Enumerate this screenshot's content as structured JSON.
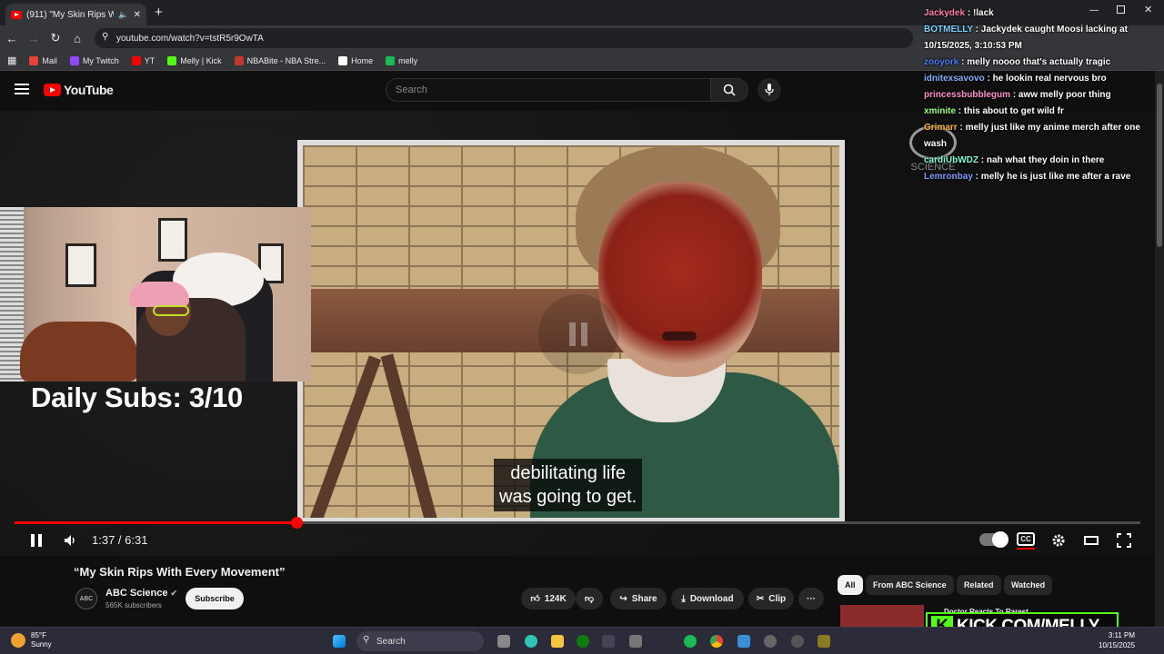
{
  "browser": {
    "tab_title": "(911) \"My Skin Rips With E",
    "url": "youtube.com/watch?v=tstR5r9OwTA",
    "bookmarks": [
      {
        "label": "Mail",
        "color": "#ea4335"
      },
      {
        "label": "My Twitch",
        "color": "#9146ff"
      },
      {
        "label": "YT",
        "color": "#ff0000"
      },
      {
        "label": "Melly | Kick",
        "color": "#53fc18"
      },
      {
        "label": "NBABite - NBA Stre...",
        "color": "#c0392b"
      },
      {
        "label": "Home",
        "color": "#ffffff"
      },
      {
        "label": "melly",
        "color": "#1db954"
      }
    ]
  },
  "youtube": {
    "logo_text": "YouTube",
    "search_placeholder": "Search"
  },
  "player": {
    "caption_line1": "debilitating life",
    "caption_line2": "was going to get.",
    "watermark": "SCIENCE",
    "current_time": "1:37",
    "duration": "6:31",
    "time_display": "1:37 / 6:31",
    "progress_fraction": 0.25,
    "cc_label": "CC"
  },
  "overlay": {
    "daily_subs": "Daily Subs: 3/10",
    "kick_text": "KICK.COM/MELLY"
  },
  "video": {
    "title": "“My Skin Rips With Every Movement”",
    "channel_name": "ABC Science",
    "channel_logo": "ABC",
    "channel_subs": "565K subscribers",
    "subscribe_label": "Subscribe",
    "likes": "124K",
    "share_label": "Share",
    "download_label": "Download",
    "clip_label": "Clip",
    "more_label": "···"
  },
  "sidebar": {
    "chips": [
      "All",
      "From ABC Science",
      "Related",
      "Watched"
    ],
    "rec_title": "Doctor Reacts To Rarest"
  },
  "chat": [
    {
      "user": "Jackydek",
      "color": "#ff7fa8",
      "text": "!lack"
    },
    {
      "user": "BOTMELLY",
      "color": "#7fd0ff",
      "text": "Jackydek caught Moosi lacking at 10/15/2025, 3:10:53 PM"
    },
    {
      "user": "zooyork",
      "color": "#4d7dff",
      "text": "melly noooo that's actually tragic"
    },
    {
      "user": "idnitexsavovo",
      "color": "#7fb0ff",
      "text": "he lookin real nervous bro"
    },
    {
      "user": "princessbubblegum",
      "color": "#ff8fd0",
      "text": "aww melly poor thing"
    },
    {
      "user": "xminite",
      "color": "#9aff7f",
      "text": "this about to get wild fr"
    },
    {
      "user": "Grimarr",
      "color": "#ffb347",
      "text": "melly just like my anime merch after one wash"
    },
    {
      "user": "cardiUbWDZ",
      "color": "#7fffd4",
      "text": "nah what they doin in there"
    },
    {
      "user": "Lemronbay",
      "color": "#7f9fff",
      "text": "melly he is just like me after a rave"
    }
  ],
  "taskbar": {
    "temp": "85°F",
    "condition": "Sunny",
    "search_label": "Search",
    "time": "3:11 PM",
    "date": "10/15/2025"
  }
}
